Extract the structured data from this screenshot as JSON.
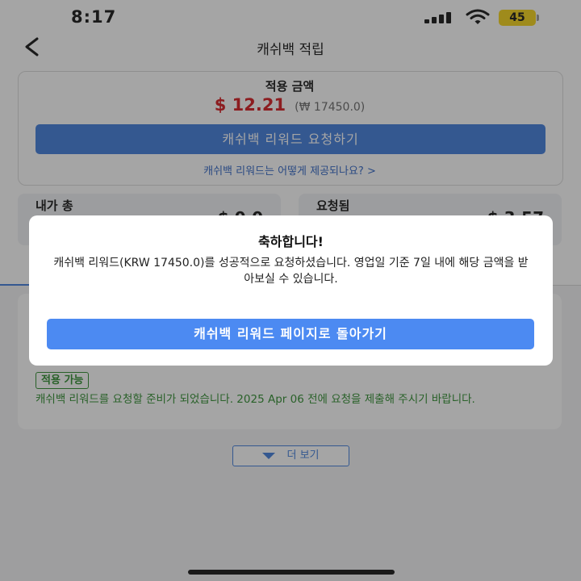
{
  "status_bar": {
    "time": "8:17",
    "battery": "45"
  },
  "nav": {
    "title": "캐쉬백 적립"
  },
  "summary": {
    "amount_title": "적용 금액",
    "amount_usd": "$ 12.21",
    "amount_krw": "(₩ 17450.0)",
    "request_button": "캐쉬백 리워드 요청하기",
    "info_link": "캐쉬백 리워드는 어떻게 제공되나요?  >"
  },
  "stats": [
    {
      "label": "내가 총",
      "value": "$ 0.0"
    },
    {
      "label": "요청됨",
      "value": "$ 3.57"
    }
  ],
  "item": {
    "badge": "적용 가능",
    "message": "캐쉬백 리워드를 요청할 준비가 되었습니다. 2025 Apr 06 전에 요청을 제출해 주시기 바랍니다."
  },
  "more_button": "더 보기",
  "modal": {
    "title": "축하합니다!",
    "body": "캐쉬백 리워드(KRW 17450.0)를 성공적으로 요청하셨습니다. 영업일 기준 7일 내에 해당 금액을 받아보실 수 있습니다.",
    "button": "캐쉬백 리워드 페이지로 돌아가기"
  },
  "colors": {
    "accent": "#3d7bdb",
    "amount_red": "#d4161b",
    "success_green": "#2a8a2a",
    "battery": "#f5d213"
  }
}
